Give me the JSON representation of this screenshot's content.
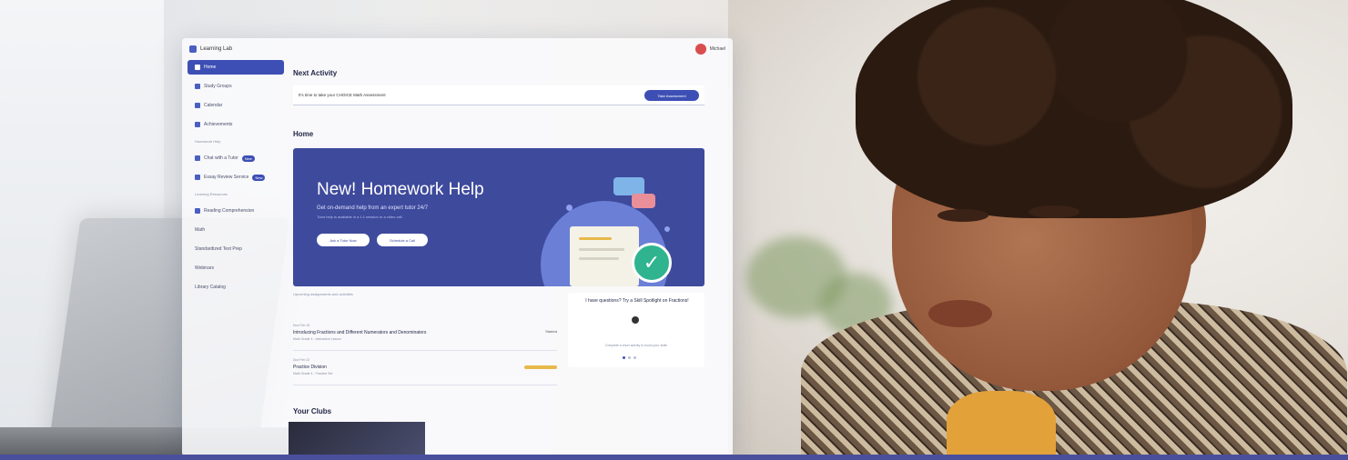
{
  "app": {
    "brand": "Learning Lab",
    "user_name": "Michael"
  },
  "sidebar": {
    "items": [
      {
        "label": "Home",
        "active": true
      },
      {
        "label": "Study Groups"
      },
      {
        "label": "Calendar"
      },
      {
        "label": "Achievements"
      }
    ],
    "section1": "Homework Help",
    "items2": [
      {
        "label": "Chat with a Tutor",
        "pill": "New"
      },
      {
        "label": "Essay Review Service",
        "pill": "New"
      }
    ],
    "section2": "Learning Resources",
    "items3": [
      {
        "label": "Reading Comprehension"
      },
      {
        "label": "Math"
      },
      {
        "label": "Standardized Test Prep"
      },
      {
        "label": "Webinars"
      },
      {
        "label": "Library Catalog"
      }
    ]
  },
  "main": {
    "next_activity_heading": "Next Activity",
    "next_activity_text": "It's time to take your CHOICE Math Assessment",
    "next_activity_button": "Take Assessment",
    "home_heading": "Home",
    "hero": {
      "title": "New! Homework Help",
      "subtitle": "Get on-demand help from an expert tutor 24/7",
      "note": "Tutor help is available in a 1:1 session or a video call",
      "button1": "Ask a Tutor Now",
      "button2": "Schedule a Call"
    },
    "caption": "Upcoming assignments and activities",
    "rows": [
      {
        "small": "Due Feb 15",
        "title": "Introducing Fractions and Different Numerators and Denominators",
        "sub": "Math Grade 4 - Interactive Lesson",
        "tag": "Started"
      },
      {
        "small": "Due Feb 22",
        "title": "Practice Division",
        "sub": "Math Grade 4 - Practice Set",
        "tag": ""
      }
    ],
    "side_card": {
      "title": "I have questions? Try a Skill Spotlight on Fractions!",
      "text": "Complete a short activity to boost your skills",
      "icon": "lightbulb-icon"
    },
    "clubs_heading": "Your Clubs"
  },
  "colors": {
    "accent": "#3d4fb5",
    "hero_bg": "#3e4a9c",
    "check": "#2fb48f",
    "highlight": "#e7b94a"
  }
}
